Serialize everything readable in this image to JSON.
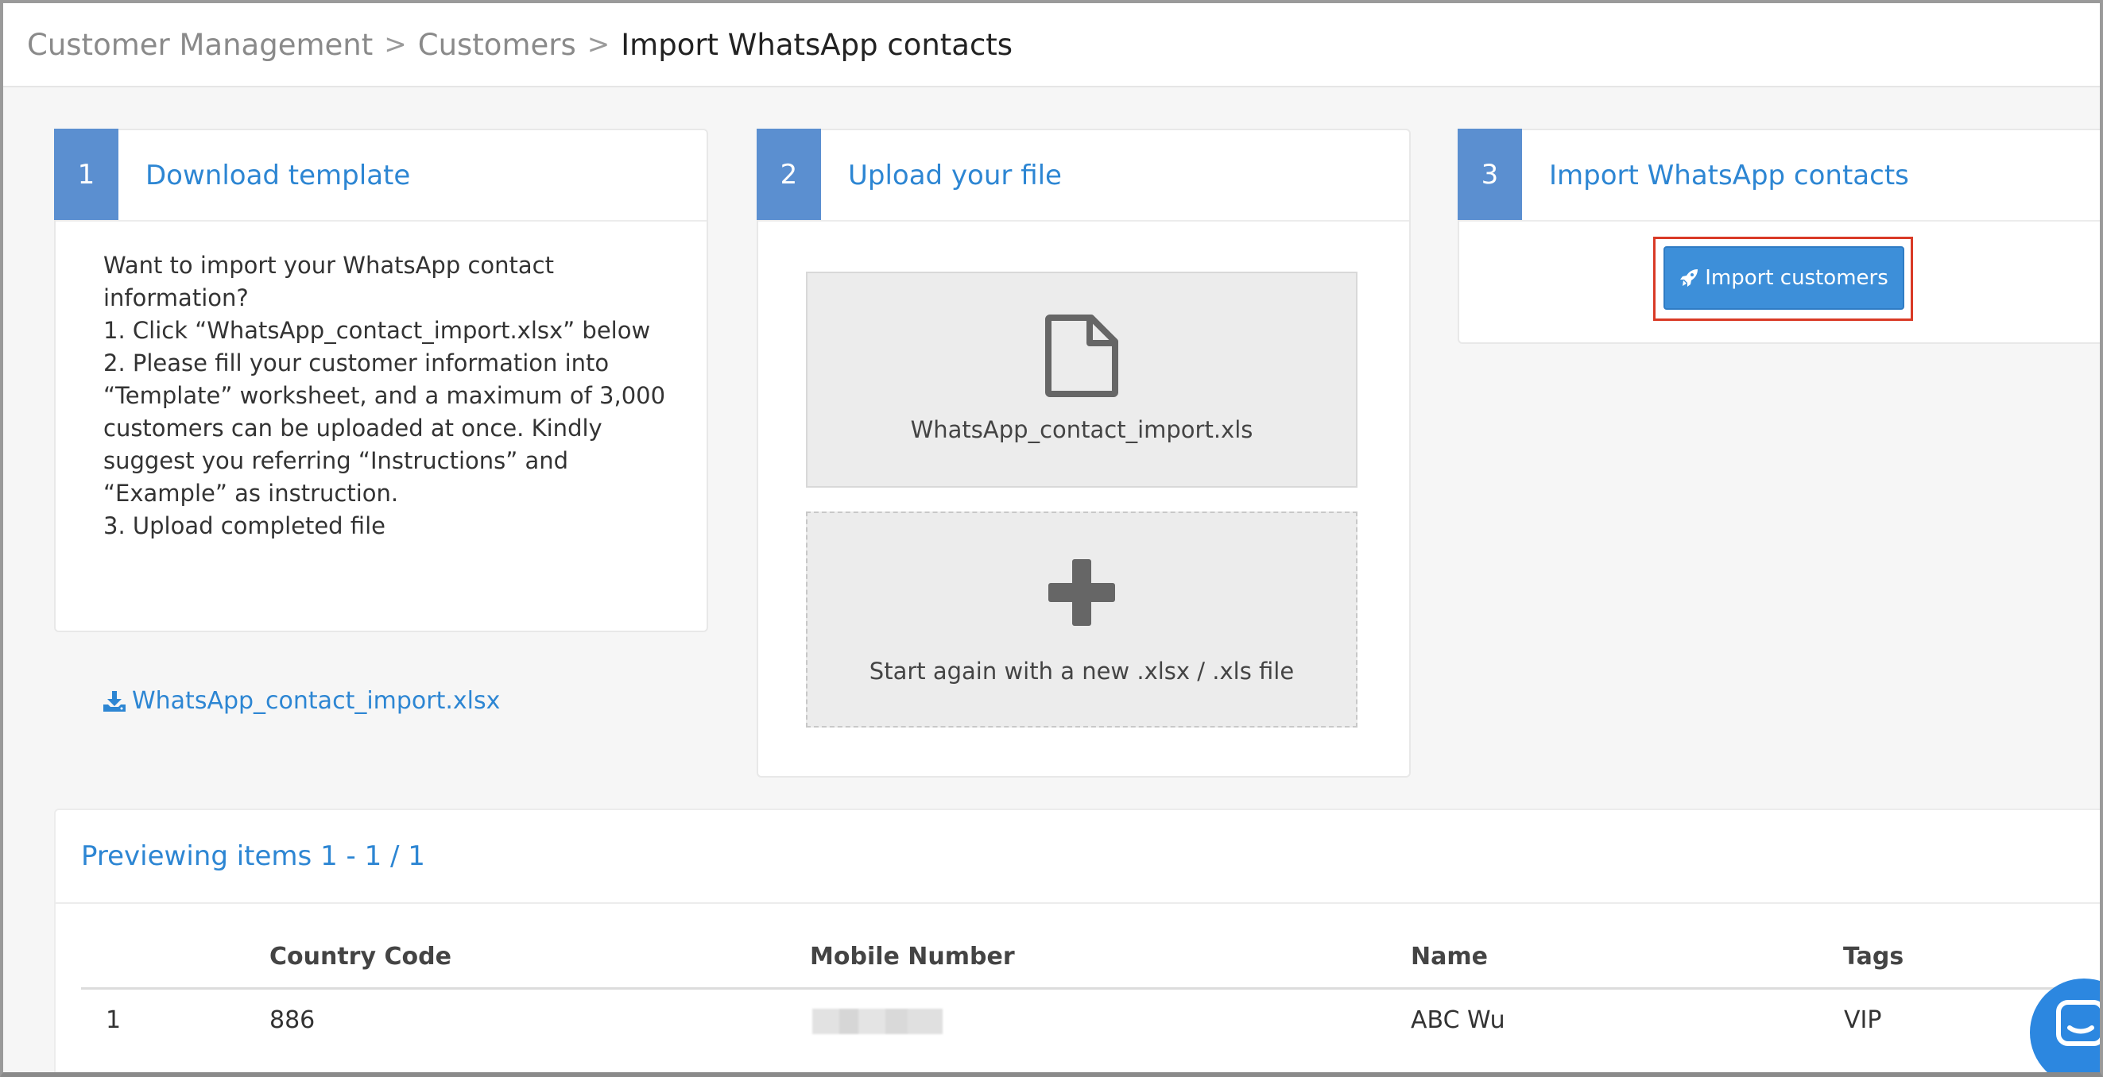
{
  "breadcrumb": {
    "items": [
      "Customer Management",
      "Customers",
      "Import WhatsApp contacts"
    ],
    "separator": ">"
  },
  "steps": [
    {
      "number": "1",
      "title": "Download template"
    },
    {
      "number": "2",
      "title": "Upload your file"
    },
    {
      "number": "3",
      "title": "Import WhatsApp contacts"
    }
  ],
  "instructions": {
    "lines": [
      "Want to import your WhatsApp contact information?",
      "1. Click “WhatsApp_contact_import.xlsx” below",
      "2. Please fill your customer information into “Template” worksheet, and a maximum of 3,000 customers can be uploaded at once. Kindly suggest you referring “Instructions” and “Example” as instruction.",
      "3. Upload completed file"
    ],
    "download_link": "WhatsApp_contact_import.xlsx"
  },
  "upload": {
    "file_name": "WhatsApp_contact_import.xls",
    "restart_label": "Start again with a new .xlsx / .xls file"
  },
  "import": {
    "button_label": "Import customers"
  },
  "preview": {
    "title": "Previewing items 1 - 1 / 1",
    "columns": [
      "Country Code",
      "Mobile Number",
      "Name",
      "Tags"
    ],
    "rows": [
      {
        "index": "1",
        "country_code": "886",
        "mobile_number": "",
        "name": "ABC Wu",
        "tags": "VIP"
      }
    ]
  },
  "colors": {
    "accent": "#2d86d3",
    "step_badge": "#5b8fd0",
    "button": "#3d8fd9",
    "highlight": "#d93a26"
  },
  "icons": {
    "download": "download-icon",
    "file": "file-icon",
    "plus": "plus-icon",
    "rocket": "rocket-icon",
    "chat": "chat-icon"
  }
}
